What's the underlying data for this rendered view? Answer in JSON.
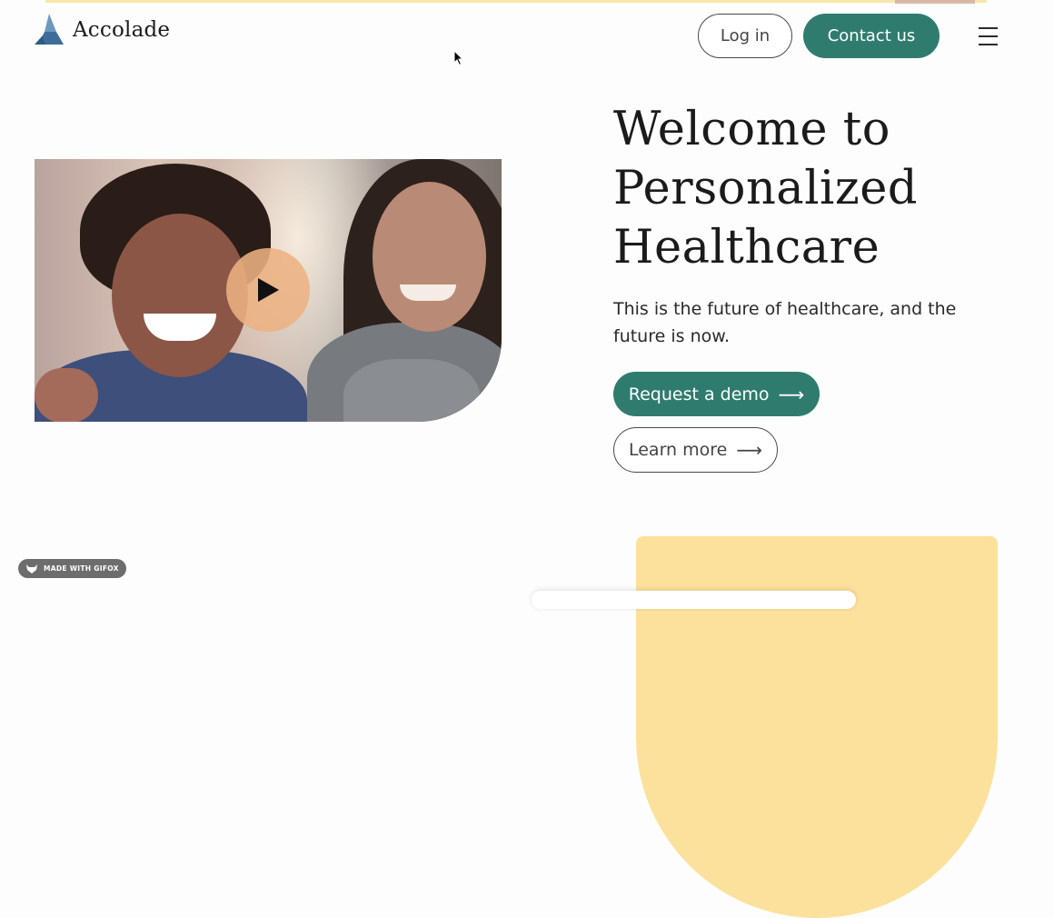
{
  "brand": {
    "name": "Accolade"
  },
  "header": {
    "login_label": "Log in",
    "contact_label": "Contact us",
    "menu_icon": "hamburger-menu-icon"
  },
  "hero": {
    "title_line1": "Welcome to",
    "title_line2": "Personalized",
    "title_line3": "Healthcare",
    "subtitle": "This is the future of healthcare, and the future is now.",
    "demo_label": "Request a demo",
    "learn_label": "Learn more",
    "arrow": "⟶"
  },
  "badge": {
    "text": "MADE WITH GIFOX"
  },
  "colors": {
    "accent": "#2f7c6e",
    "play_button": "#ecb282",
    "yellow": "#fbe19b",
    "logo_blue": "#3d6e9a"
  }
}
